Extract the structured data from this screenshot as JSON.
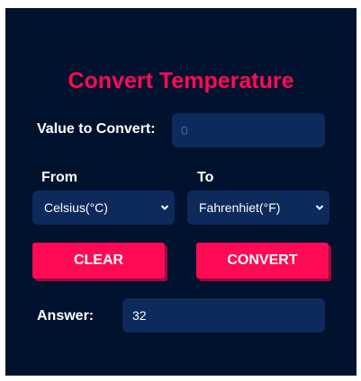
{
  "app": {
    "title": "Convert Temperature"
  },
  "form": {
    "value_label": "Value to Convert:",
    "value_input": {
      "value": "",
      "placeholder": "0"
    },
    "from_label": "From",
    "from_select": {
      "selected": "Celsius(°C)"
    },
    "to_label": "To",
    "to_select": {
      "selected": "Fahrenhiet(°F)"
    }
  },
  "buttons": {
    "clear_label": "CLEAR",
    "convert_label": "CONVERT"
  },
  "answer": {
    "label": "Answer:",
    "value": "32"
  },
  "colors": {
    "background": "#01122e",
    "field": "#0c2a5b",
    "accent": "#ff0a54",
    "text": "#ffffff"
  },
  "icons": {
    "dropdown": "chevron-down-icon"
  }
}
